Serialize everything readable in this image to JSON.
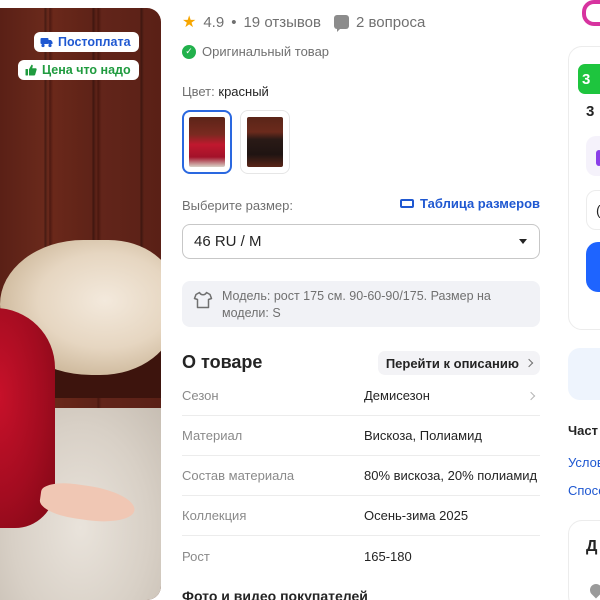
{
  "gallery": {
    "badges": [
      {
        "label": "Постоплата",
        "icon": "truck-icon",
        "color": "#1f58d1"
      },
      {
        "label": "Цена что надо",
        "icon": "thumbs-up-icon",
        "color": "#1f9b3f"
      }
    ]
  },
  "rating": {
    "value": "4.9",
    "reviews": "19 отзывов",
    "separator": "•",
    "questions": "2 вопроса"
  },
  "original": {
    "label": "Оригинальный товар"
  },
  "color": {
    "label": "Цвет:",
    "value": "красный",
    "options": [
      "red-dress",
      "dark-coat"
    ],
    "selected_index": 0
  },
  "size": {
    "label": "Выберите размер:",
    "table_link": "Таблица размеров",
    "selected": "46 RU / M"
  },
  "model_note": {
    "text": "Модель: рост 175 см. 90-60-90/175. Размер на модели: S"
  },
  "about": {
    "title": "О товаре",
    "to_description": "Перейти к описанию",
    "specs": [
      {
        "key": "Сезон",
        "value": "Демисезон"
      },
      {
        "key": "Материал",
        "value": "Вискоза, Полиамид"
      },
      {
        "key": "Состав материала",
        "value": "80% вискоза, 20% полиамид"
      },
      {
        "key": "Коллекция",
        "value": "Осень-зима 2025"
      },
      {
        "key": "Рост",
        "value": "165-180"
      }
    ]
  },
  "photos_section": {
    "title": "Фото и видео покупателей"
  },
  "side": {
    "chip_text": "3",
    "digit_text": "3",
    "grey_text": "(",
    "bold_text": "Част",
    "link1": "Услов",
    "link2": "Спосо",
    "card_letter": "Д"
  },
  "colors": {
    "accent": "#1f58d1",
    "brand_pink": "#d7339f",
    "green": "#1ec53e",
    "star": "#f7a600"
  }
}
